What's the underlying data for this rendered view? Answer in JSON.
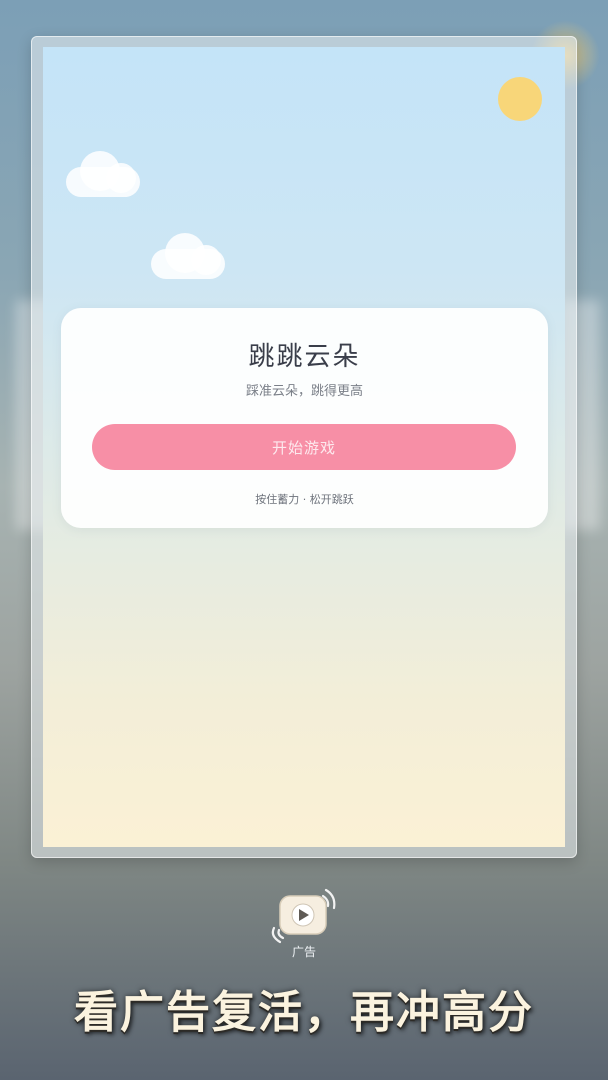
{
  "game": {
    "title": "跳跳云朵",
    "subtitle": "踩准云朵，跳得更高",
    "start_button_label": "开始游戏",
    "hint": "按住蓄力 · 松开跳跃"
  },
  "ad": {
    "icon": "video-play-icon",
    "label": "广告"
  },
  "promo": {
    "text": "看广告复活，再冲高分"
  },
  "colors": {
    "sky_top": "#c4e4f8",
    "sky_bottom": "#fbf1d5",
    "sun": "#f8d679",
    "start_button": "#f78fa6",
    "promo_text": "#fbf3df"
  }
}
